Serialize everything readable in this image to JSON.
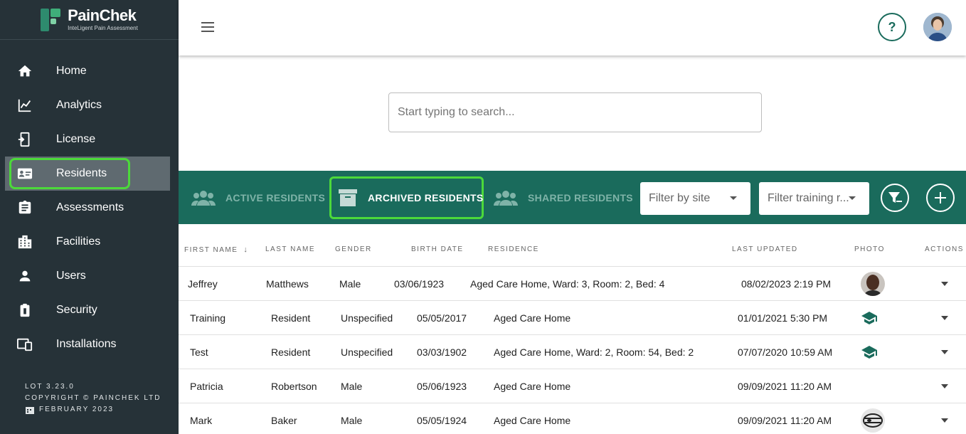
{
  "brand": {
    "name": "PainChek",
    "tagline": "InteLigent Pain Assessment"
  },
  "sidebar": {
    "items": [
      {
        "label": "Home",
        "icon": "home-icon"
      },
      {
        "label": "Analytics",
        "icon": "analytics-icon"
      },
      {
        "label": "License",
        "icon": "license-icon"
      },
      {
        "label": "Residents",
        "icon": "residents-icon",
        "active": true
      },
      {
        "label": "Assessments",
        "icon": "assessments-icon"
      },
      {
        "label": "Facilities",
        "icon": "facilities-icon"
      },
      {
        "label": "Users",
        "icon": "users-icon"
      },
      {
        "label": "Security",
        "icon": "security-icon"
      },
      {
        "label": "Installations",
        "icon": "installations-icon"
      }
    ],
    "footer": {
      "version": "LOT 3.23.0",
      "copyright": "COPYRIGHT © PAINCHEK LTD",
      "date": "FEBRUARY 2023"
    }
  },
  "header": {
    "help_label": "?"
  },
  "search": {
    "placeholder": "Start typing to search..."
  },
  "tabs": [
    {
      "label": "ACTIVE RESIDENTS",
      "icon": "group-icon"
    },
    {
      "label": "ARCHIVED RESIDENTS",
      "icon": "archive-box-icon",
      "selected": true
    },
    {
      "label": "SHARED RESIDENTS",
      "icon": "group-icon"
    }
  ],
  "filters": {
    "site": "Filter by site",
    "training": "Filter training r..."
  },
  "table": {
    "columns": [
      "FIRST NAME",
      "LAST NAME",
      "GENDER",
      "BIRTH DATE",
      "RESIDENCE",
      "LAST UPDATED",
      "PHOTO",
      "ACTIONS"
    ],
    "rows": [
      {
        "first": "Jeffrey",
        "last": "Matthews",
        "gender": "Male",
        "birth": "03/06/1923",
        "residence": "Aged Care Home, Ward: 3, Room: 2, Bed: 4",
        "updated": "08/02/2023 2:19 PM",
        "photo": "portrait"
      },
      {
        "first": "Training",
        "last": "Resident",
        "gender": "Unspecified",
        "birth": "05/05/2017",
        "residence": "Aged Care Home",
        "updated": "01/01/2021 5:30 PM",
        "photo": "graduation-cap-icon"
      },
      {
        "first": "Test",
        "last": "Resident",
        "gender": "Unspecified",
        "birth": "03/03/1902",
        "residence": "Aged Care Home, Ward: 2, Room: 54, Bed: 2",
        "updated": "07/07/2020 10:59 AM",
        "photo": "graduation-cap-icon"
      },
      {
        "first": "Patricia",
        "last": "Robertson",
        "gender": "Male",
        "birth": "05/06/1923",
        "residence": "Aged Care Home",
        "updated": "09/09/2021 11:20 AM",
        "photo": "none"
      },
      {
        "first": "Mark",
        "last": "Baker",
        "gender": "Male",
        "birth": "05/05/1924",
        "residence": "Aged Care Home",
        "updated": "09/09/2021 11:20 AM",
        "photo": "sketch"
      }
    ]
  },
  "colors": {
    "sidebar": "#263238",
    "accent": "#1a6b5c",
    "highlight": "#4cd93a"
  }
}
